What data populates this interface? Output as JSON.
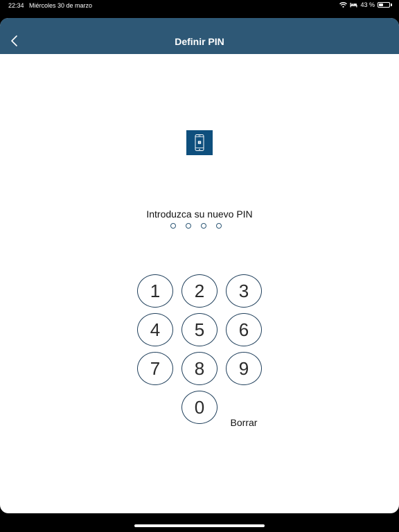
{
  "status_bar": {
    "time": "22:34",
    "date": "Miércoles 30 de marzo",
    "battery_text": "43 %",
    "battery_level": 0.43
  },
  "nav": {
    "title": "Definir PIN"
  },
  "pin": {
    "prompt": "Introduzca su nuevo PIN",
    "length": 4,
    "entered": 0
  },
  "keypad": {
    "key_1": "1",
    "key_2": "2",
    "key_3": "3",
    "key_4": "4",
    "key_5": "5",
    "key_6": "6",
    "key_7": "7",
    "key_8": "8",
    "key_9": "9",
    "key_0": "0",
    "delete_label": "Borrar"
  },
  "colors": {
    "nav_background": "#2e5876",
    "icon_tile": "#0e4f7d",
    "key_border": "#1f3f5b"
  },
  "icons": {
    "back": "chevron-left-icon",
    "phone": "smartphone-icon",
    "wifi": "wifi-icon",
    "bed": "bed-icon",
    "battery": "battery-icon"
  }
}
